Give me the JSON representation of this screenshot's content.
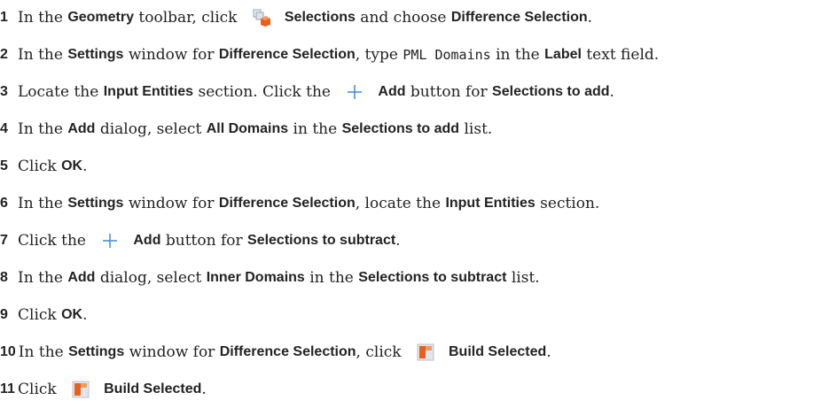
{
  "icons": {
    "selections": "selections-icon",
    "add": "plus-icon",
    "build": "build-selected-icon"
  },
  "colors": {
    "accent_orange": "#e8601c",
    "add_blue": "#4a90d9"
  },
  "steps": [
    {
      "num": "1",
      "segments": [
        {
          "t": "text",
          "v": "In the "
        },
        {
          "t": "bold",
          "v": "Geometry"
        },
        {
          "t": "text",
          "v": " toolbar, click "
        },
        {
          "t": "icon",
          "v": "selections"
        },
        {
          "t": "bold",
          "v": "Selections"
        },
        {
          "t": "text",
          "v": " and choose "
        },
        {
          "t": "bold",
          "v": "Difference Selection"
        },
        {
          "t": "text",
          "v": "."
        }
      ]
    },
    {
      "num": "2",
      "segments": [
        {
          "t": "text",
          "v": "In the "
        },
        {
          "t": "bold",
          "v": "Settings"
        },
        {
          "t": "text",
          "v": " window for "
        },
        {
          "t": "bold",
          "v": "Difference Selection"
        },
        {
          "t": "text",
          "v": ", type "
        },
        {
          "t": "code",
          "v": "PML Domains"
        },
        {
          "t": "text",
          "v": " in the "
        },
        {
          "t": "bold",
          "v": "Label"
        },
        {
          "t": "text",
          "v": " text field."
        }
      ]
    },
    {
      "num": "3",
      "segments": [
        {
          "t": "text",
          "v": "Locate the "
        },
        {
          "t": "bold",
          "v": "Input Entities"
        },
        {
          "t": "text",
          "v": " section. Click the "
        },
        {
          "t": "icon",
          "v": "add"
        },
        {
          "t": "bold",
          "v": "Add"
        },
        {
          "t": "text",
          "v": " button for "
        },
        {
          "t": "bold",
          "v": "Selections to add"
        },
        {
          "t": "text",
          "v": "."
        }
      ]
    },
    {
      "num": "4",
      "segments": [
        {
          "t": "text",
          "v": "In the "
        },
        {
          "t": "bold",
          "v": "Add"
        },
        {
          "t": "text",
          "v": " dialog, select "
        },
        {
          "t": "bold",
          "v": "All Domains"
        },
        {
          "t": "text",
          "v": " in the "
        },
        {
          "t": "bold",
          "v": "Selections to add"
        },
        {
          "t": "text",
          "v": " list."
        }
      ]
    },
    {
      "num": "5",
      "segments": [
        {
          "t": "text",
          "v": "Click "
        },
        {
          "t": "bold",
          "v": "OK"
        },
        {
          "t": "text",
          "v": "."
        }
      ]
    },
    {
      "num": "6",
      "segments": [
        {
          "t": "text",
          "v": "In the "
        },
        {
          "t": "bold",
          "v": "Settings"
        },
        {
          "t": "text",
          "v": " window for "
        },
        {
          "t": "bold",
          "v": "Difference Selection"
        },
        {
          "t": "text",
          "v": ", locate the "
        },
        {
          "t": "bold",
          "v": "Input Entities"
        },
        {
          "t": "text",
          "v": " section."
        }
      ]
    },
    {
      "num": "7",
      "segments": [
        {
          "t": "text",
          "v": "Click the "
        },
        {
          "t": "icon",
          "v": "add"
        },
        {
          "t": "bold",
          "v": "Add"
        },
        {
          "t": "text",
          "v": " button for "
        },
        {
          "t": "bold",
          "v": "Selections to subtract"
        },
        {
          "t": "text",
          "v": "."
        }
      ]
    },
    {
      "num": "8",
      "segments": [
        {
          "t": "text",
          "v": "In the "
        },
        {
          "t": "bold",
          "v": "Add"
        },
        {
          "t": "text",
          "v": " dialog, select "
        },
        {
          "t": "bold",
          "v": "Inner Domains"
        },
        {
          "t": "text",
          "v": " in the "
        },
        {
          "t": "bold",
          "v": "Selections to subtract"
        },
        {
          "t": "text",
          "v": " list."
        }
      ]
    },
    {
      "num": "9",
      "segments": [
        {
          "t": "text",
          "v": "Click "
        },
        {
          "t": "bold",
          "v": "OK"
        },
        {
          "t": "text",
          "v": "."
        }
      ]
    },
    {
      "num": "10",
      "segments": [
        {
          "t": "text",
          "v": "In the "
        },
        {
          "t": "bold",
          "v": "Settings"
        },
        {
          "t": "text",
          "v": " window for "
        },
        {
          "t": "bold",
          "v": "Difference Selection"
        },
        {
          "t": "text",
          "v": ", click "
        },
        {
          "t": "icon",
          "v": "build"
        },
        {
          "t": "bold",
          "v": "Build Selected"
        },
        {
          "t": "text",
          "v": "."
        }
      ]
    },
    {
      "num": "11",
      "segments": [
        {
          "t": "text",
          "v": "Click "
        },
        {
          "t": "icon",
          "v": "build"
        },
        {
          "t": "bold",
          "v": "Build Selected"
        },
        {
          "t": "text",
          "v": "."
        }
      ]
    }
  ]
}
